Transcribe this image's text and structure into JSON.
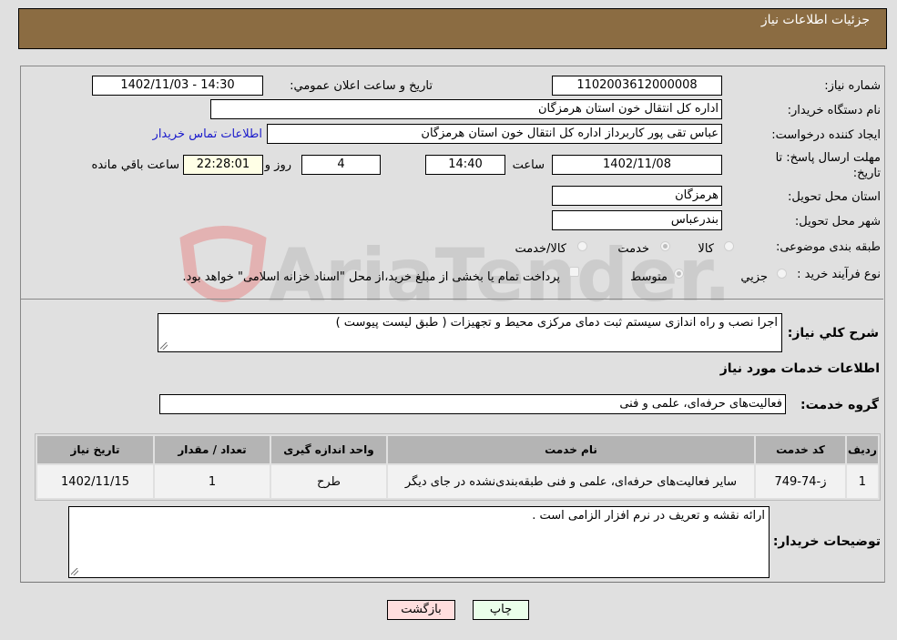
{
  "header": {
    "title": "جزئيات اطلاعات نياز"
  },
  "form": {
    "need_number": {
      "label": "شماره نیاز:",
      "value": "1102003612000008"
    },
    "announce_datetime": {
      "label": "تاريخ و ساعت اعلان عمومي:",
      "value": "1402/11/03 - 14:30"
    },
    "buyer_org": {
      "label": "نام دستگاه خریدار:",
      "value": "اداره كل انتقال خون استان هرمزگان"
    },
    "requester": {
      "label": "ایجاد کننده درخواست:",
      "value": "عباس تقی پور کاربرداز اداره كل انتقال خون استان هرمزگان"
    },
    "buyer_contact_link": "اطلاعات تماس خریدار",
    "deadline": {
      "label_line1": "مهلت ارسال پاسخ: تا",
      "label_line2": "تاریخ:",
      "date": "1402/11/08",
      "time_label": "ساعت",
      "time": "14:40",
      "days": "4",
      "days_label": "روز و",
      "remaining": "22:28:01",
      "remaining_label": "ساعت باقي مانده"
    },
    "delivery_province": {
      "label": "استان محل تحویل:",
      "value": "هرمزگان"
    },
    "delivery_city": {
      "label": "شهر محل تحویل:",
      "value": "بندرعباس"
    },
    "category": {
      "label": "طبقه بندی موضوعی:",
      "options": [
        "كالا",
        "خدمت",
        "كالا/خدمت"
      ],
      "selected": "خدمت"
    },
    "purchase_type": {
      "label": "نوع فرآیند خرید :",
      "options": [
        "جزيي",
        "متوسط"
      ],
      "selected": "متوسط",
      "treasury_note": "پرداخت تمام یا بخشی از مبلغ خرید،از محل \"اسناد خزانه اسلامی\" خواهد بود."
    },
    "general_description": {
      "label": "شرح كلي نياز:",
      "value": "اجرا نصب و راه اندازی سیستم ثبت دمای مرکزی محیط و تجهیزات ( طبق لیست پیوست )"
    },
    "services_section_title": "اطلاعات خدمات مورد نياز",
    "service_group": {
      "label": "گروه خدمت:",
      "value": "فعاليت‌هاى حرفه‌اى، علمى و فنى"
    }
  },
  "table": {
    "headers": [
      "رديف",
      "كد خدمت",
      "نام خدمت",
      "واحد اندازه گيری",
      "تعداد / مقدار",
      "تاريخ نياز"
    ],
    "rows": [
      [
        "1",
        "ز-74-749",
        "ساير فعاليت‌هاى حرفه‌اى، علمى و فنى طبقه‌بندى‌نشده در جاى ديگر",
        "طرح",
        "1",
        "1402/11/15"
      ]
    ]
  },
  "buyer_notes": {
    "label": "توضيحات خريدار:",
    "value": "ارائه نقشه و تعریف در نرم افزار الزامی است ."
  },
  "buttons": {
    "print": "چاپ",
    "back": "بازگشت"
  },
  "watermark": "AriaTender.neT"
}
